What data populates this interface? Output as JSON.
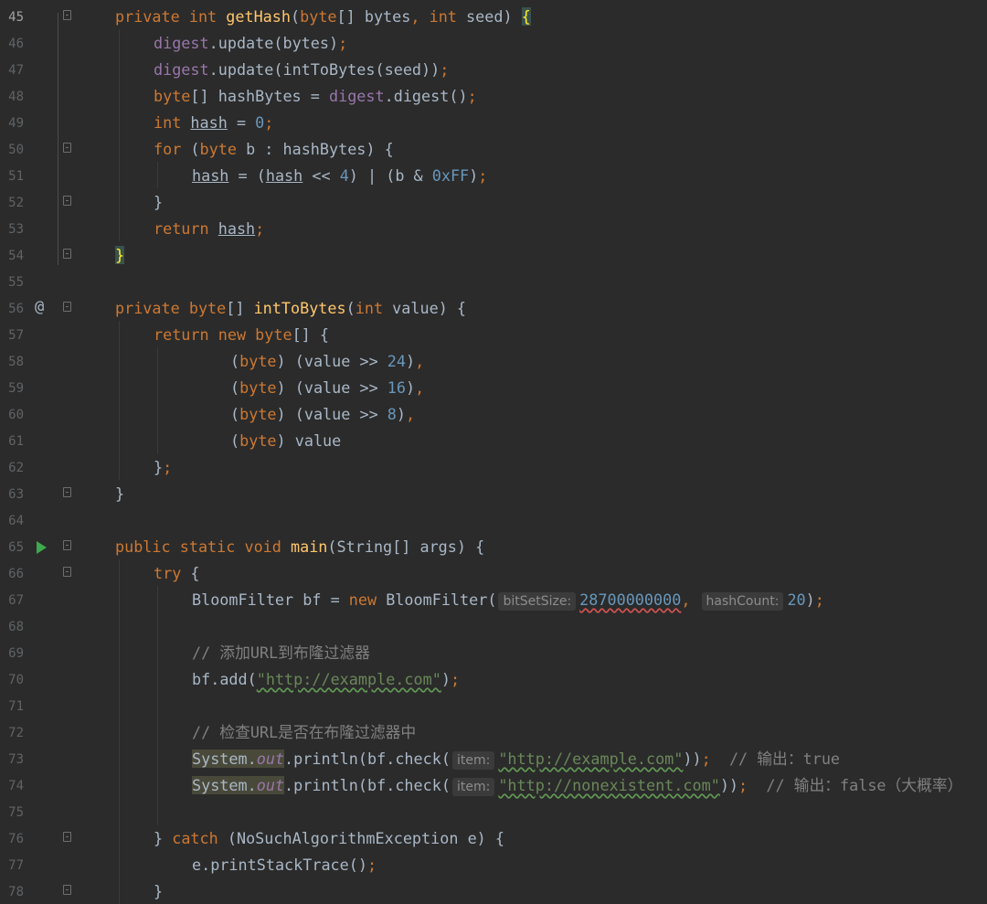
{
  "editor": {
    "language": "Java",
    "current_line": 45,
    "lines": [
      {
        "n": "45",
        "text": "private int getHash(byte[] bytes, int seed) {"
      },
      {
        "n": "46",
        "text": "digest.update(bytes);"
      },
      {
        "n": "47",
        "text": "digest.update(intToBytes(seed));"
      },
      {
        "n": "48",
        "text": "byte[] hashBytes = digest.digest();"
      },
      {
        "n": "49",
        "text": "int hash = 0;"
      },
      {
        "n": "50",
        "text": "for (byte b : hashBytes) {"
      },
      {
        "n": "51",
        "text": "hash = (hash << 4) | (b & 0xFF);"
      },
      {
        "n": "52",
        "text": "}"
      },
      {
        "n": "53",
        "text": "return hash;"
      },
      {
        "n": "54",
        "text": "}"
      },
      {
        "n": "55",
        "text": ""
      },
      {
        "n": "56",
        "text": "private byte[] intToBytes(int value) {"
      },
      {
        "n": "57",
        "text": "return new byte[] {"
      },
      {
        "n": "58",
        "text": "(byte) (value >> 24),"
      },
      {
        "n": "59",
        "text": "(byte) (value >> 16),"
      },
      {
        "n": "60",
        "text": "(byte) (value >> 8),"
      },
      {
        "n": "61",
        "text": "(byte) value"
      },
      {
        "n": "62",
        "text": "};"
      },
      {
        "n": "63",
        "text": "}"
      },
      {
        "n": "64",
        "text": ""
      },
      {
        "n": "65",
        "text": "public static void main(String[] args) {"
      },
      {
        "n": "66",
        "text": "try {"
      },
      {
        "n": "67",
        "text": "BloomFilter bf = new BloomFilter( bitSetSize: 28700000000,  hashCount: 20);"
      },
      {
        "n": "68",
        "text": ""
      },
      {
        "n": "69",
        "text": "// 添加URL到布隆过滤器"
      },
      {
        "n": "70",
        "text": "bf.add(\"http://example.com\");"
      },
      {
        "n": "71",
        "text": ""
      },
      {
        "n": "72",
        "text": "// 检查URL是否在布隆过滤器中"
      },
      {
        "n": "73",
        "text": "System.out.println(bf.check( item: \"http://example.com\"));  // 输出：true"
      },
      {
        "n": "74",
        "text": "System.out.println(bf.check( item: \"http://nonexistent.com\"));  // 输出：false（大概率）"
      },
      {
        "n": "75",
        "text": ""
      },
      {
        "n": "76",
        "text": "} catch (NoSuchAlgorithmException e) {"
      },
      {
        "n": "77",
        "text": "e.printStackTrace();"
      },
      {
        "n": "78",
        "text": "}"
      }
    ],
    "tokens": {
      "private": "private",
      "int": "int",
      "getHash": "getHash",
      "byte": "byte",
      "bytes": "bytes",
      "seed": "seed",
      "digest": "digest",
      "update": "update",
      "intToBytes": "intToBytes",
      "hashBytes": "hashBytes",
      "hash": "hash",
      "zero": "0",
      "for": "for",
      "b": "b",
      "four": "4",
      "hexFF": "0xFF",
      "return": "return",
      "value": "value",
      "new": "new",
      "n24": "24",
      "n16": "16",
      "n8": "8",
      "public": "public",
      "static": "static",
      "void": "void",
      "main": "main",
      "String": "String",
      "args": "args",
      "try": "try",
      "BloomFilter": "BloomFilter",
      "bf": "bf",
      "bitSetSize": "bitSetSize:",
      "bitSetValue": "28700000000",
      "hashCount": "hashCount:",
      "hashCountValue": "20",
      "comment_add": "// 添加URL到布隆过滤器",
      "add": "add",
      "url_example": "\"http://example.com\"",
      "comment_check": "// 检查URL是否在布隆过滤器中",
      "System": "System",
      "out": "out",
      "println": "println",
      "check": "check",
      "item": "item:",
      "url_nonexistent": "\"http://nonexistent.com\"",
      "comment_true": "// 输出：true",
      "comment_false": "// 输出：false（大概率）",
      "catch": "catch",
      "exception": "NoSuchAlgorithmException",
      "e": "e",
      "printStackTrace": "printStackTrace",
      "at_icon": "@"
    }
  },
  "colors": {
    "background": "#2b2b2b",
    "keyword": "#cc7832",
    "function": "#ffc66d",
    "number": "#6897bb",
    "string": "#6a8759",
    "field": "#9876aa",
    "comment": "#808080",
    "run": "#3ea94e"
  },
  "icons": {
    "run": "run-icon",
    "override": "implements-icon",
    "fold": "fold-icon"
  }
}
